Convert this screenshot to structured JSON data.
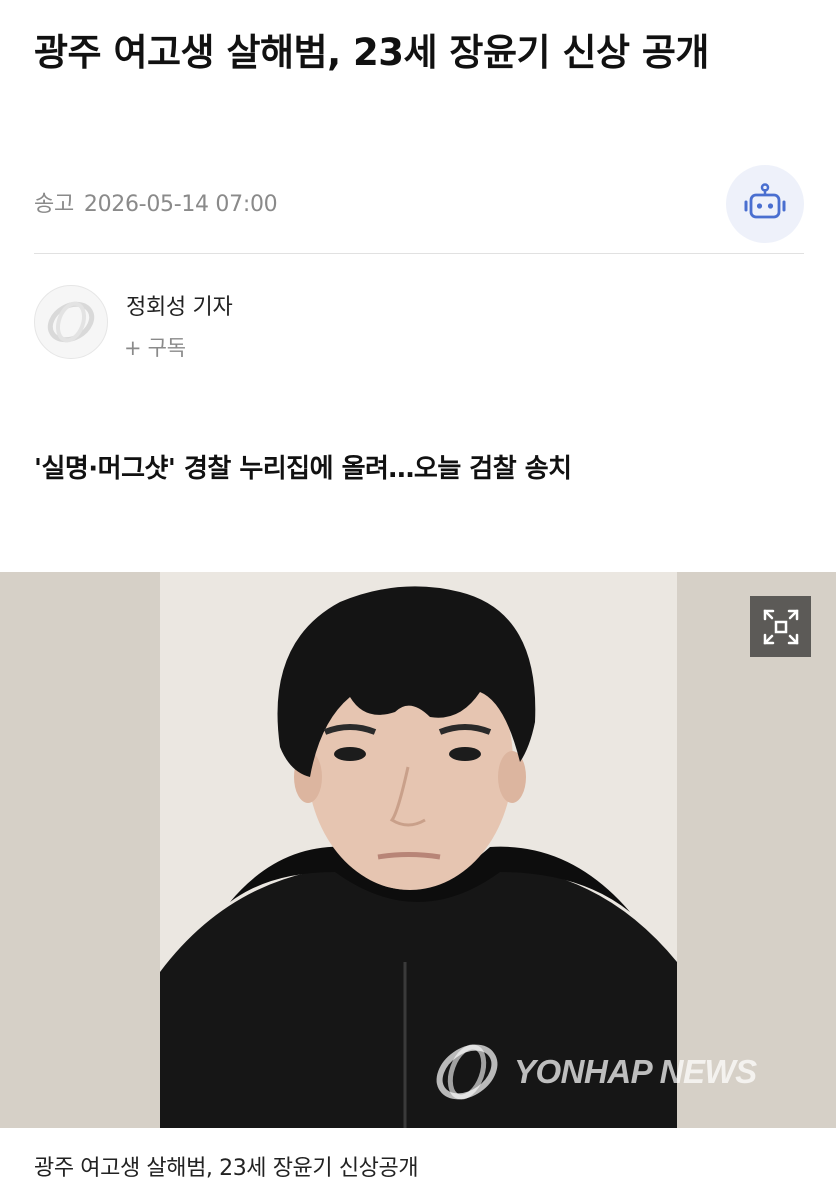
{
  "article": {
    "headline": "광주 여고생 살해범, 23세 장윤기 신상 공개",
    "meta_label": "송고",
    "meta_datetime": "2026-05-14 07:00",
    "reporter_name": "정회성 기자",
    "subscribe_label": "+ 구독",
    "subheadline": "'실명·머그샷' 경찰 누리집에 올려…오늘 검찰 송치"
  },
  "photo": {
    "watermark_text": "YONHAP NEWS",
    "caption": "광주 여고생 살해범, 23세 장윤기 신상공개"
  },
  "icons": {
    "ai_bot": "robot-icon",
    "expand": "expand-icon",
    "reporter_avatar": "yonhap-logo-icon"
  }
}
